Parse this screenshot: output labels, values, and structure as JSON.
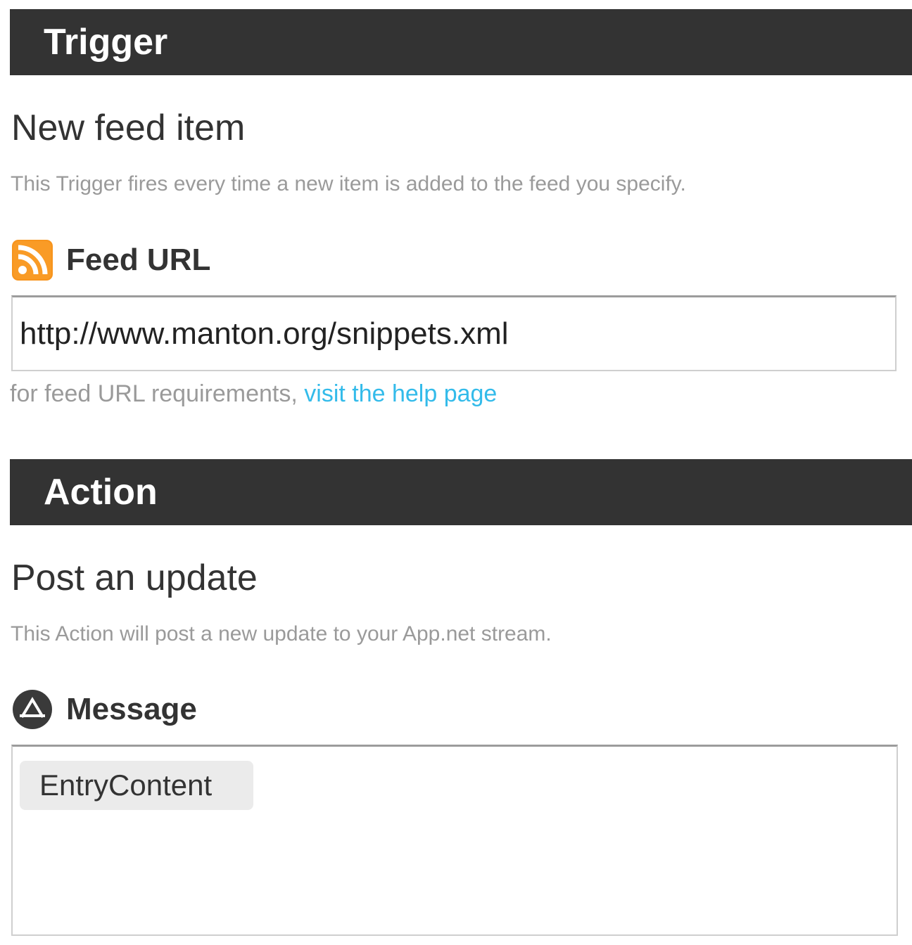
{
  "trigger": {
    "section_title": "Trigger",
    "name": "New feed item",
    "description": "This Trigger fires every time a new item is added to the feed you specify.",
    "field": {
      "icon": "rss-feed-icon",
      "label": "Feed URL",
      "value": "http://www.manton.org/snippets.xml"
    },
    "help": {
      "text": "for feed URL requirements, ",
      "link_text": "visit the help page"
    }
  },
  "action": {
    "section_title": "Action",
    "name": "Post an update",
    "description": "This Action will post a new update to your App.net stream.",
    "field": {
      "icon": "appnet-icon",
      "label": "Message",
      "ingredients": [
        "EntryContent"
      ]
    }
  },
  "colors": {
    "section_bar": "#333333",
    "link": "#33bbea",
    "rss_orange": "#f7941d",
    "pill_bg": "#ebebeb"
  }
}
